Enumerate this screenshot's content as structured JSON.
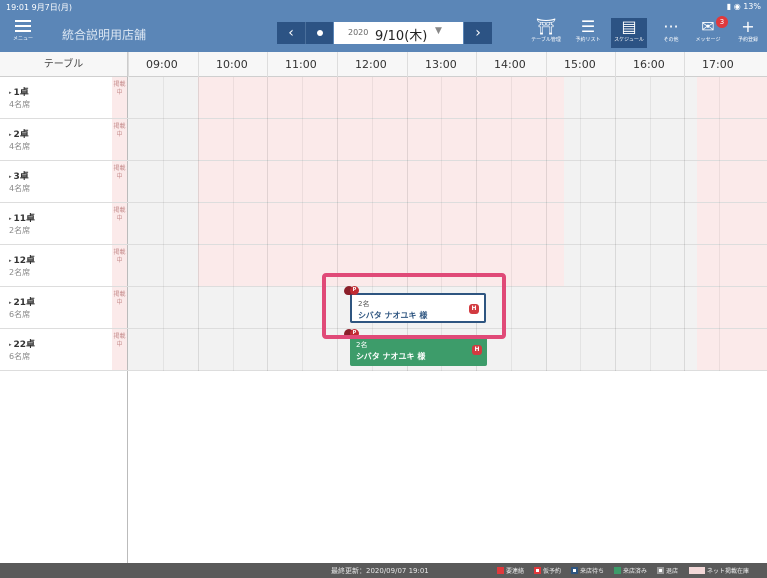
{
  "status": {
    "time": "19:01  9月7日(月)",
    "right": "13%"
  },
  "header": {
    "menu_label": "メニュー",
    "store_name": "統合説明用店舗",
    "prev_icon": "chevron-left-icon",
    "next_icon": "chevron-right-icon",
    "date_year": "2020",
    "date_main": "9/10(木)",
    "date_caret": "▼",
    "nav": [
      {
        "label": "テーブル管理",
        "icon": "table-icon",
        "glyph": "⛩"
      },
      {
        "label": "予約リスト",
        "icon": "list-icon",
        "glyph": "☰"
      },
      {
        "label": "スケジュール",
        "icon": "schedule-icon",
        "glyph": "▤"
      },
      {
        "label": "その他",
        "icon": "more-icon",
        "glyph": "···"
      },
      {
        "label": "メッセージ",
        "icon": "message-icon",
        "glyph": "✉"
      },
      {
        "label": "予約登録",
        "icon": "add-icon",
        "glyph": "+"
      }
    ],
    "message_badge": "3"
  },
  "table_header": "テーブル",
  "times": [
    "09:00",
    "10:00",
    "11:00",
    "12:00",
    "13:00",
    "14:00",
    "15:00",
    "16:00",
    "17:00"
  ],
  "rows": [
    {
      "name": "1卓",
      "seats": "4名席",
      "pub": "掲載中"
    },
    {
      "name": "2卓",
      "seats": "4名席",
      "pub": "掲載中"
    },
    {
      "name": "3卓",
      "seats": "4名席",
      "pub": "掲載中"
    },
    {
      "name": "11卓",
      "seats": "2名席",
      "pub": "掲載中"
    },
    {
      "name": "12卓",
      "seats": "2名席",
      "pub": "掲載中"
    },
    {
      "name": "21卓",
      "seats": "6名席",
      "pub": "掲載中"
    },
    {
      "name": "22卓",
      "seats": "6名席",
      "pub": "掲載中"
    }
  ],
  "reservations": [
    {
      "count": "2名",
      "name": "シバタ ナオユキ 様",
      "badge": "H",
      "flag": "P",
      "status": "仮予約"
    },
    {
      "count": "2名",
      "name": "シバタ ナオユキ 様",
      "badge": "H",
      "flag": "P",
      "status": "来店済み"
    }
  ],
  "footer": {
    "updated": "最終更新：2020/09/07 19:01",
    "legend": [
      {
        "label": "要連絡",
        "color": "#e0393c"
      },
      {
        "label": "仮予約",
        "color": "#e0393c"
      },
      {
        "label": "来店待ち",
        "color": "#2e5580"
      },
      {
        "label": "来店済み",
        "color": "#3d9c6a"
      },
      {
        "label": "退店",
        "color": "#9a9a9a"
      },
      {
        "label": "ネット掲載在庫",
        "color": "#f3d8d8"
      }
    ]
  },
  "colors": {
    "header_bg": "#5b86b7",
    "nav_button_bg": "#2c5384",
    "pink_zone": "#fbeaea",
    "highlight": "#e04a78"
  }
}
